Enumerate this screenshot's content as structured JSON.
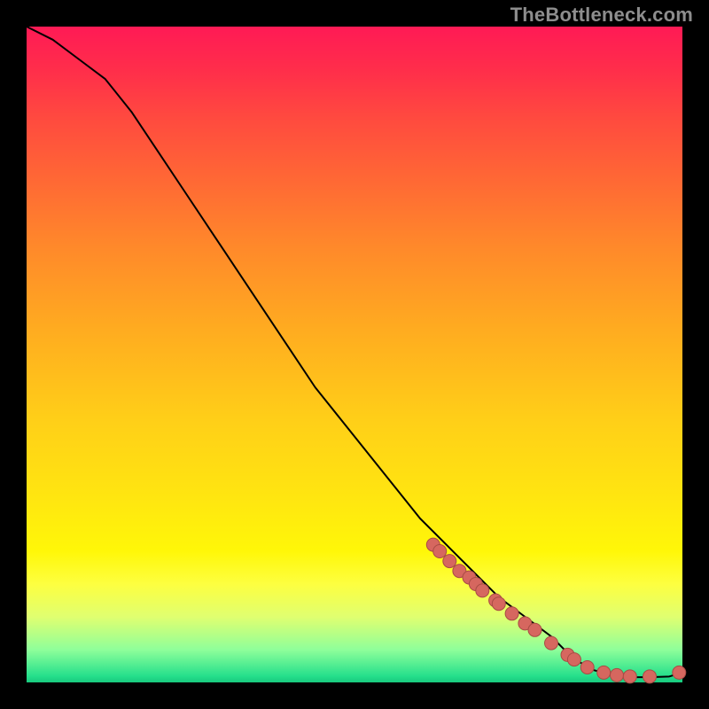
{
  "watermark": "TheBottleneck.com",
  "colors": {
    "curve": "#000000",
    "marker_fill": "#d6675f",
    "marker_stroke": "#a84b44"
  },
  "chart_data": {
    "type": "line",
    "title": "",
    "xlabel": "",
    "ylabel": "",
    "xlim": [
      0,
      100
    ],
    "ylim": [
      0,
      100
    ],
    "grid": false,
    "legend": false,
    "series": [
      {
        "name": "bottleneck-curve",
        "x": [
          0,
          4,
          8,
          12,
          16,
          20,
          24,
          28,
          32,
          36,
          40,
          44,
          48,
          52,
          56,
          60,
          64,
          68,
          72,
          76,
          80,
          83,
          86,
          89,
          92,
          95,
          98,
          100
        ],
        "y": [
          100,
          98,
          95,
          92,
          87,
          81,
          75,
          69,
          63,
          57,
          51,
          45,
          40,
          35,
          30,
          25,
          21,
          17,
          13,
          10,
          7,
          4,
          2,
          1.2,
          0.8,
          0.8,
          0.9,
          1.5
        ]
      }
    ],
    "markers": {
      "name": "highlighted-points",
      "x": [
        62,
        63,
        64.5,
        66,
        67.5,
        68.5,
        69.5,
        71.5,
        72,
        74,
        76,
        77.5,
        80,
        82.5,
        83.5,
        85.5,
        88,
        90,
        92,
        95,
        99.5
      ],
      "y": [
        21,
        20,
        18.5,
        17,
        16,
        15,
        14,
        12.5,
        12,
        10.5,
        9,
        8,
        6,
        4.2,
        3.5,
        2.3,
        1.5,
        1.1,
        0.9,
        0.9,
        1.5
      ]
    }
  }
}
